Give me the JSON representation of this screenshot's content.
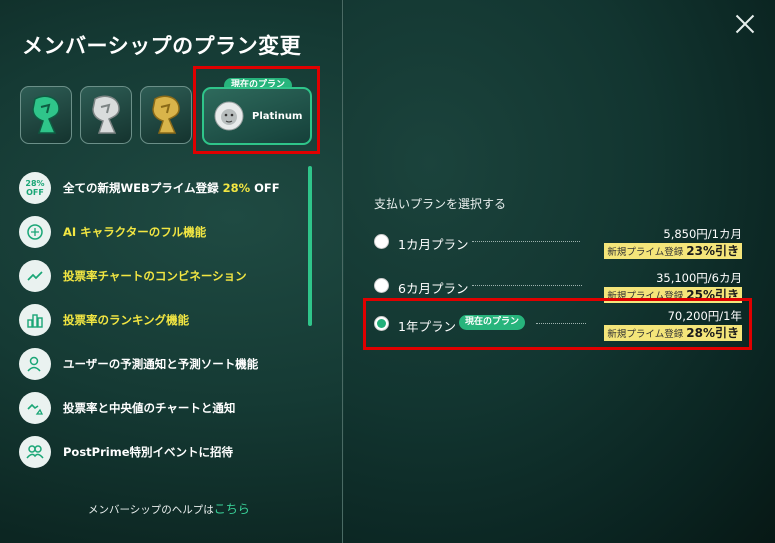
{
  "modal": {
    "title": "メンバーシップのプラン変更",
    "current_badge": "現在のプラン",
    "current_plan_name": "Platinum",
    "plan_tiles": [
      {
        "icon": "green-lion-icon",
        "color": "#2fc58a"
      },
      {
        "icon": "silver-lion-icon",
        "color": "#d9dcdc"
      },
      {
        "icon": "gold-lion-icon",
        "color": "#d9b44a"
      }
    ],
    "features": [
      {
        "icon": "28%\nOFF",
        "pre": "全ての新規WEBプライム登録 ",
        "highlight": "28%",
        "post": " OFF"
      },
      {
        "icon": "ai-brain-icon",
        "text": "AI キャラクターのフル機能"
      },
      {
        "icon": "chart-combination-icon",
        "text": "投票率チャートのコンビネーション"
      },
      {
        "icon": "ranking-icon",
        "text": "投票率のランキング機能"
      },
      {
        "icon": "user-search-icon",
        "text": "ユーザーの予測通知と予測ソート機能"
      },
      {
        "icon": "chart-bell-icon",
        "text": "投票率と中央値のチャートと通知"
      },
      {
        "icon": "users-icon",
        "text": "PostPrime特別イベントに招待"
      }
    ],
    "help_text": "メンバーシップのヘルプは",
    "help_link": "こちら"
  },
  "payment": {
    "label": "支払いプランを選択する",
    "options": [
      {
        "name": "1カ月プラン",
        "price": "5,850円/1カ月",
        "disc_label": "新規プライム登録 ",
        "disc_value": "23%引き",
        "selected": false
      },
      {
        "name": "6カ月プラン",
        "price": "35,100円/6カ月",
        "disc_label": "新規プライム登録 ",
        "disc_value": "25%引き",
        "selected": false
      },
      {
        "name": "1年プラン",
        "badge": "現在のプラン",
        "price": "70,200円/1年",
        "disc_label": "新規プライム登録 ",
        "disc_value": "28%引き",
        "selected": true
      }
    ]
  },
  "colors": {
    "accent": "#27b47c",
    "highlight": "#f2e642",
    "alert_outline": "#e00000"
  }
}
